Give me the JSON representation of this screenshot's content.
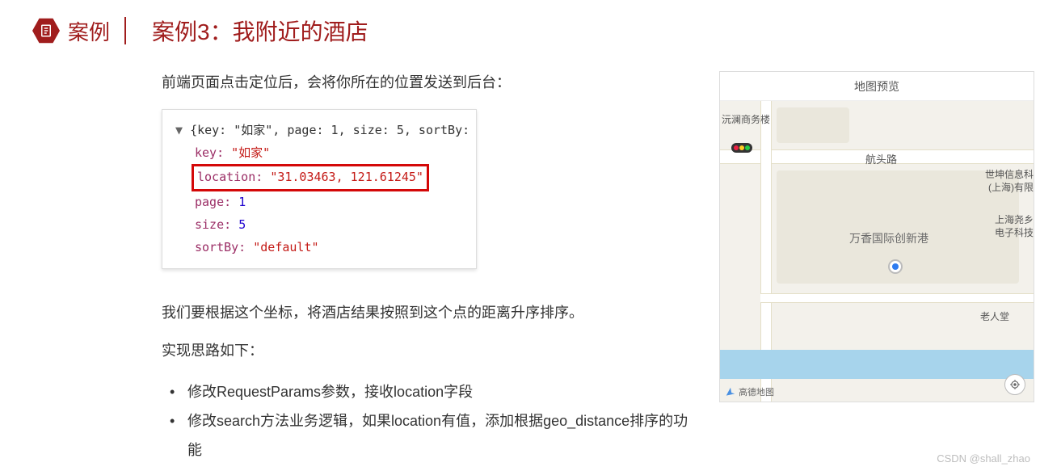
{
  "header": {
    "badge_label": "案例",
    "title": "案例3：我附近的酒店"
  },
  "intro": "前端页面点击定位后，会将你所在的位置发送到后台：",
  "code": {
    "obj_prefix": "{key: \"如家\", page: 1, size: 5, sortBy:",
    "lines": {
      "key_prop": "key:",
      "key_val": "\"如家\"",
      "loc_prop": "location:",
      "loc_val": "\"31.03463, 121.61245\"",
      "page_prop": "page:",
      "page_val": "1",
      "size_prop": "size:",
      "size_val": "5",
      "sort_prop": "sortBy:",
      "sort_val": "\"default\""
    }
  },
  "para2": "我们要根据这个坐标，将酒店结果按照到这个点的距离升序排序。",
  "para3": "实现思路如下：",
  "bullets": [
    "修改RequestParams参数，接收location字段",
    "修改search方法业务逻辑，如果location有值，添加根据geo_distance排序的功能"
  ],
  "map": {
    "title": "地图预览",
    "labels": {
      "top_left": "沅澜商务楼",
      "road": "航头路",
      "right1": "世坤信息科",
      "right1b": "(上海)有限",
      "right2a": "上海尧乡",
      "right2b": "电子科技",
      "center": "万香国际创新港",
      "bottom_right": "老人堂"
    },
    "logo_text": "高德地图"
  },
  "watermark": "CSDN @shall_zhao"
}
